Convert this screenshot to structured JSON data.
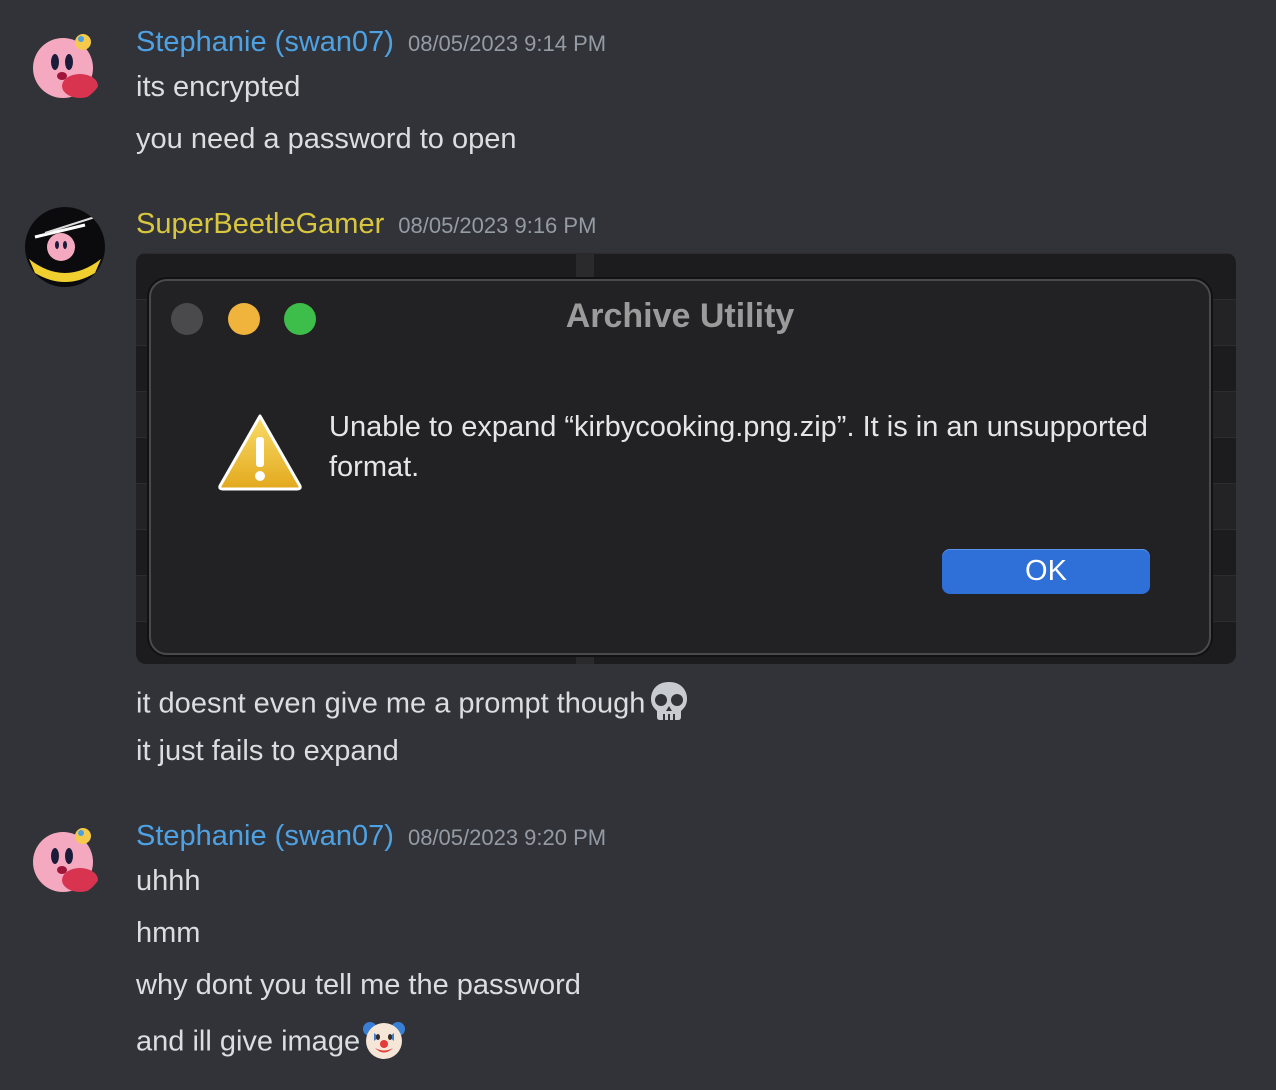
{
  "messages": [
    {
      "username": "Stephanie (swan07)",
      "timestamp": "08/05/2023 9:14 PM",
      "color": "#4ea2e3",
      "lines": [
        "its encrypted",
        "you need a password to open"
      ]
    },
    {
      "username": "SuperBeetleGamer",
      "timestamp": "08/05/2023 9:16 PM",
      "color": "#d9c63f",
      "attachment": {
        "dialog_title": "Archive Utility",
        "dialog_message": "Unable to expand “kirbycooking.png.zip”. It is in an unsupported format.",
        "ok_label": "OK",
        "warning_icon": "warning-triangle-icon"
      },
      "lines": [
        "it doesnt even give me a prompt though",
        "it just fails to expand"
      ],
      "emoji": "skull-emoji"
    },
    {
      "username": "Stephanie (swan07)",
      "timestamp": "08/05/2023 9:20 PM",
      "color": "#4ea2e3",
      "lines": [
        "uhhh",
        "hmm",
        "why dont you tell me the password",
        "and ill give image"
      ],
      "emoji": "clown-face-emoji"
    }
  ]
}
